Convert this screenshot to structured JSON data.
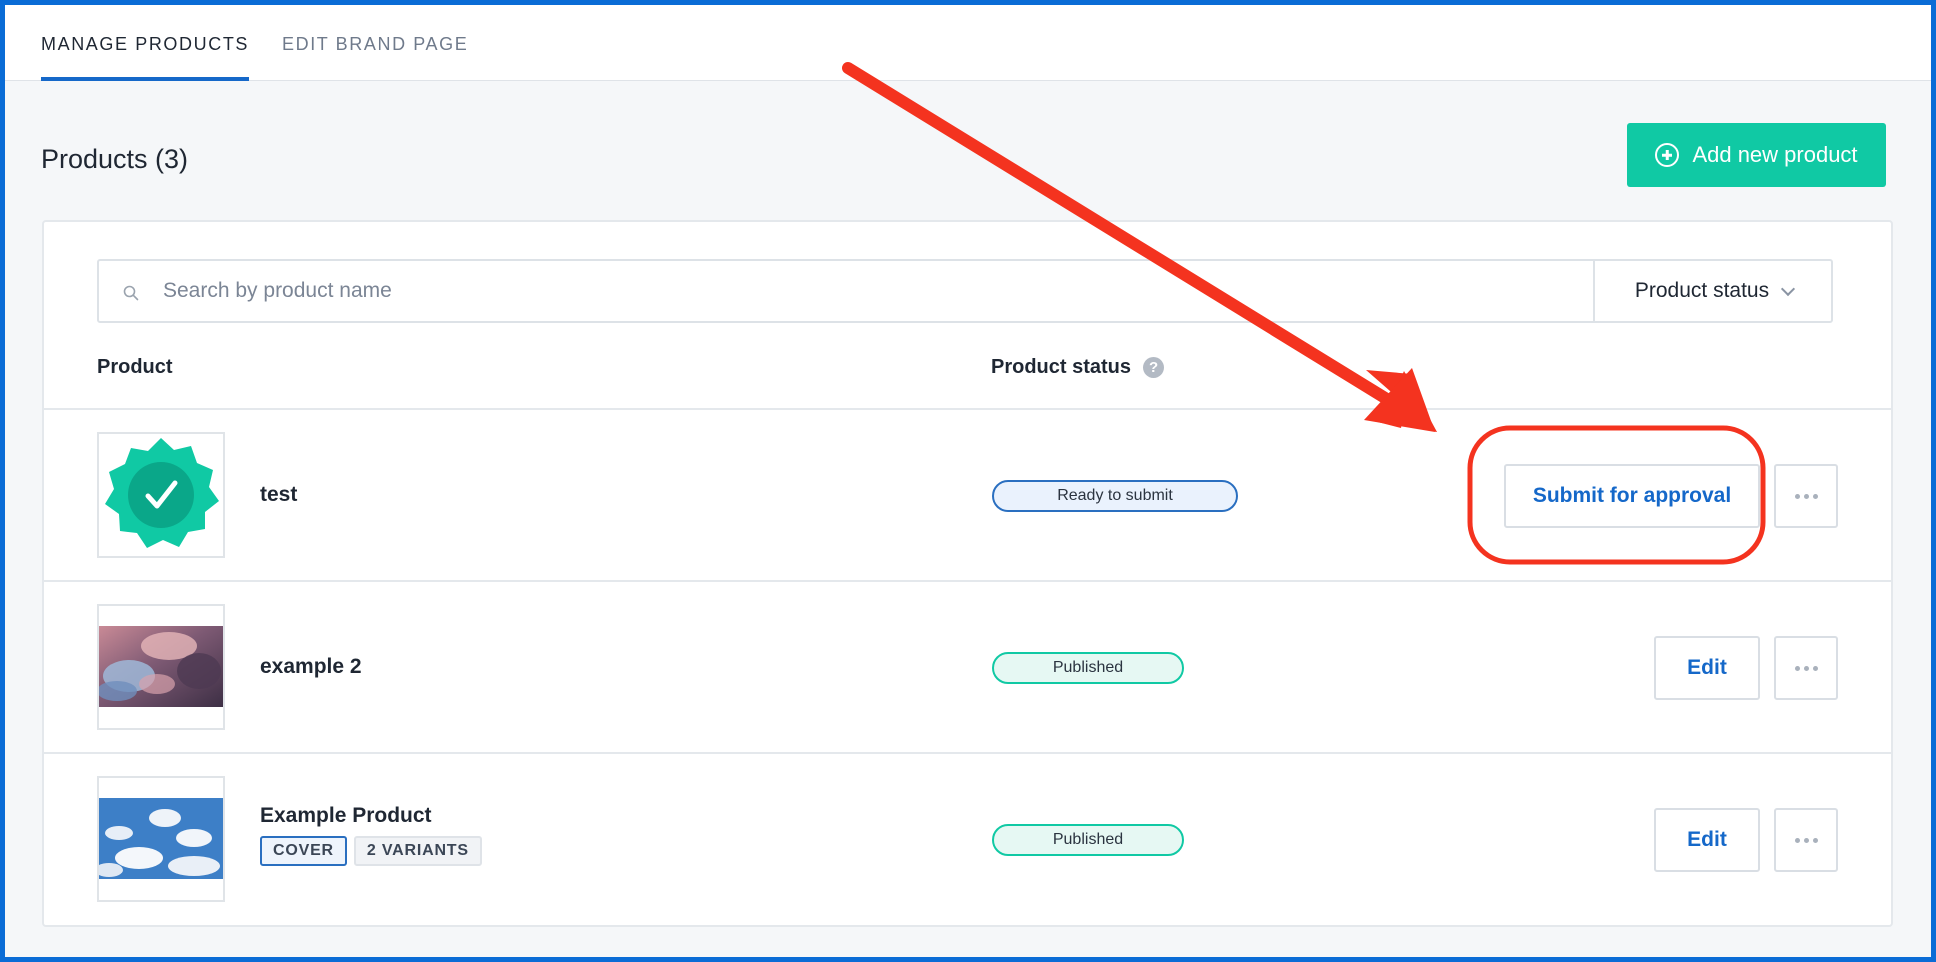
{
  "tabs": [
    {
      "label": "MANAGE PRODUCTS",
      "active": true
    },
    {
      "label": "EDIT BRAND PAGE",
      "active": false
    }
  ],
  "header": {
    "title": "Products (3)",
    "add_button_label": "Add new product"
  },
  "search": {
    "placeholder": "Search by product name",
    "value": ""
  },
  "filter": {
    "label": "Product status"
  },
  "columns": {
    "product": "Product",
    "status": "Product status",
    "help": "?"
  },
  "products": [
    {
      "name": "test",
      "status": "Ready to submit",
      "action": "Submit for approval",
      "thumbnail": "badge-check-icon"
    },
    {
      "name": "example 2",
      "status": "Published",
      "action": "Edit",
      "thumbnail": "cloudy-sunset-image"
    },
    {
      "name": "Example Product",
      "status": "Published",
      "action": "Edit",
      "thumbnail": "blue-sky-clouds-image",
      "tags": [
        "COVER",
        "2 VARIANTS"
      ]
    }
  ],
  "colors": {
    "accent_blue": "#1568c9",
    "brand_green": "#10c9a4",
    "annotation_red": "#f4331f",
    "frame_blue": "#0a6cd6"
  }
}
